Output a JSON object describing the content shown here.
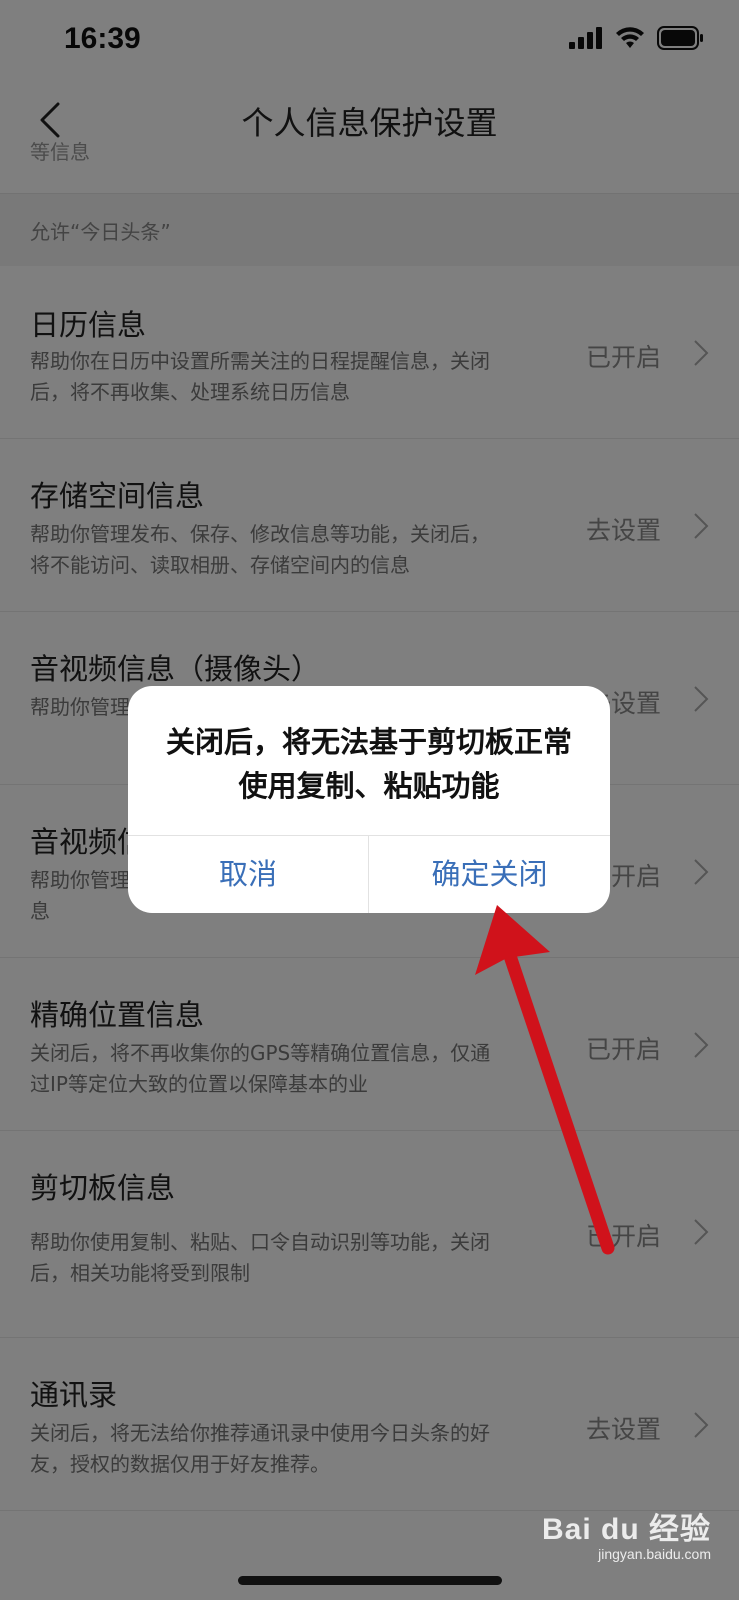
{
  "status_bar": {
    "time": "16:39"
  },
  "nav": {
    "title": "个人信息保护设置"
  },
  "clipped_row_text": "等信息",
  "section_header": "允许“今日头条”",
  "rows": [
    {
      "title": "日历信息",
      "desc": "帮助你在日历中设置所需关注的日程提醒信息，关闭后，将不再收集、处理系统日历信息",
      "status": "已开启"
    },
    {
      "title": "存储空间信息",
      "desc": "帮助你管理发布、保存、修改信息等功能，关闭后，将不能访问、读取相册、存储空间内的信息",
      "status": "去设置"
    },
    {
      "title": "音视频信息（摄像头）",
      "desc": "帮助你管理…视频信息，…",
      "status": "去设置"
    },
    {
      "title": "音视频信息",
      "desc": "帮助你管理…搜索等功能，关闭后将不能采集语音信息",
      "status": "已开启"
    },
    {
      "title": "精确位置信息",
      "desc": "关闭后，将不再收集你的GPS等精确位置信息，仅通过IP等定位大致的位置以保障基本的业",
      "status": "已开启"
    },
    {
      "title": "剪切板信息",
      "desc": "帮助你使用复制、粘贴、口令自动识别等功能，关闭后，相关功能将受到限制",
      "status": "已开启"
    },
    {
      "title": "通讯录",
      "desc": "关闭后，将无法给你推荐通讯录中使用今日头条的好友，授权的数据仅用于好友推荐。",
      "status": "去设置"
    }
  ],
  "dialog": {
    "message": "关闭后，将无法基于剪切板正常使用复制、粘贴功能",
    "cancel_label": "取消",
    "confirm_label": "确定关闭"
  },
  "watermark": {
    "brand": "Bai du 经验",
    "url": "jingyan.baidu.com"
  },
  "colors": {
    "dialog_button": "#3a6fb8",
    "arrow": "#d0121b",
    "overlay": "rgba(0,0,0,0.5)"
  }
}
